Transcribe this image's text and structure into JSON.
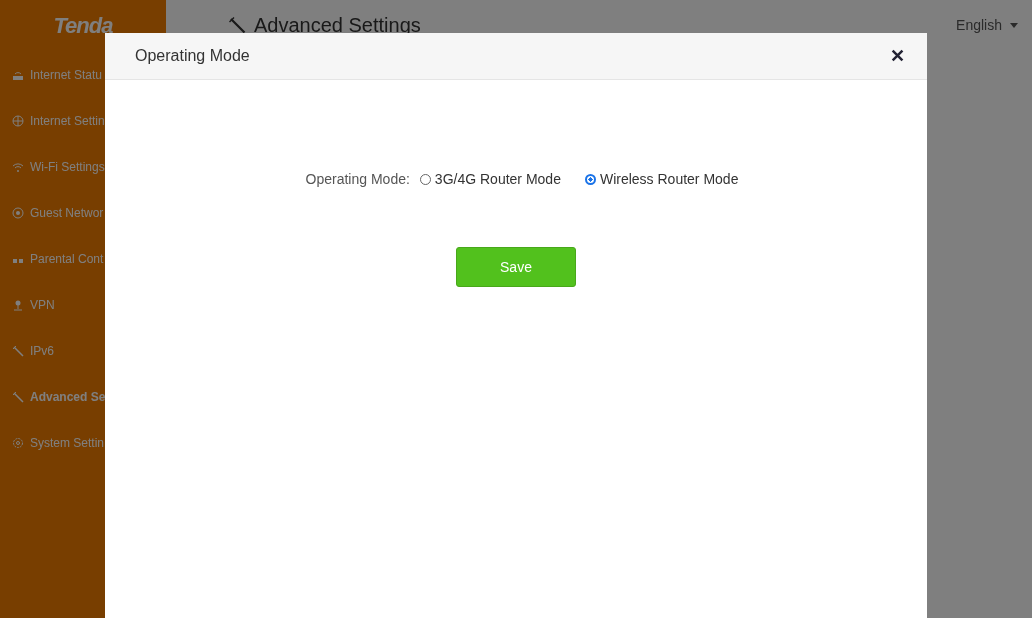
{
  "sidebar": {
    "logo": "Tenda",
    "items": [
      {
        "label": "Internet Statu",
        "selected": false
      },
      {
        "label": "Internet Settin",
        "selected": false
      },
      {
        "label": "Wi-Fi Settings",
        "selected": false
      },
      {
        "label": "Guest Networ",
        "selected": false
      },
      {
        "label": "Parental Cont",
        "selected": false
      },
      {
        "label": "VPN",
        "selected": false
      },
      {
        "label": "IPv6",
        "selected": false
      },
      {
        "label": "Advanced Se",
        "selected": true
      },
      {
        "label": "System Settin",
        "selected": false
      }
    ]
  },
  "header": {
    "title": "Advanced Settings",
    "language": "English"
  },
  "dialog": {
    "title": "Operating Mode",
    "close": "✕",
    "field_label": "Operating Mode:",
    "options": [
      {
        "label": "3G/4G Router Mode",
        "selected": false
      },
      {
        "label": "Wireless Router Mode",
        "selected": true
      }
    ],
    "save_button": "Save"
  }
}
